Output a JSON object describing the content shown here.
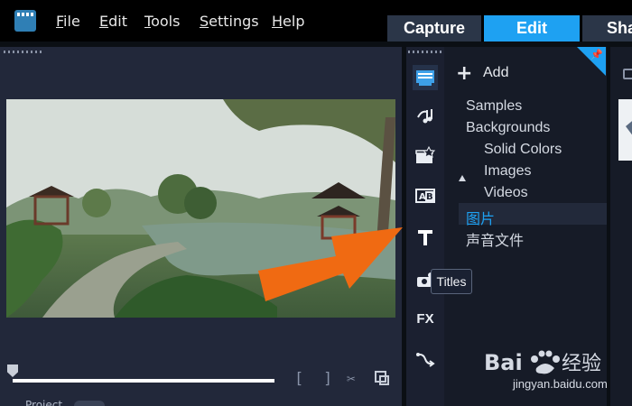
{
  "menu": {
    "items": [
      {
        "label": "File",
        "underline": "F",
        "rest": "ile"
      },
      {
        "label": "Edit",
        "underline": "E",
        "rest": "dit"
      },
      {
        "label": "Tools",
        "underline": "T",
        "rest": "ools"
      },
      {
        "label": "Settings",
        "underline": "S",
        "rest": "ettings"
      },
      {
        "label": "Help",
        "underline": "H",
        "rest": "elp"
      }
    ]
  },
  "tabs": {
    "capture": "Capture",
    "edit": "Edit",
    "share": "Sha"
  },
  "preview": {
    "project_label": "Project"
  },
  "sidebar": {
    "icons": [
      "media-icon",
      "audio-icon",
      "instant-project-icon",
      "transition-icon",
      "titles-icon",
      "graphics-icon",
      "fx-icon",
      "motion-path-icon"
    ],
    "fx_label": "FX",
    "titles_tooltip": "Titles"
  },
  "library": {
    "add_label": "Add",
    "tree": [
      {
        "label": "Samples",
        "level": 0
      },
      {
        "label": "Backgrounds",
        "level": 0,
        "expanded": true
      },
      {
        "label": "Solid Colors",
        "level": 1
      },
      {
        "label": "Images",
        "level": 1
      },
      {
        "label": "Videos",
        "level": 1
      },
      {
        "label": "图片",
        "level": 0,
        "selected": true
      },
      {
        "label": "声音文件",
        "level": 0
      }
    ]
  },
  "watermark": {
    "brand": "Baidu经验",
    "url": "jingyan.baidu.com"
  },
  "colors": {
    "accent": "#1ea1f2",
    "arrow": "#f06a12"
  }
}
